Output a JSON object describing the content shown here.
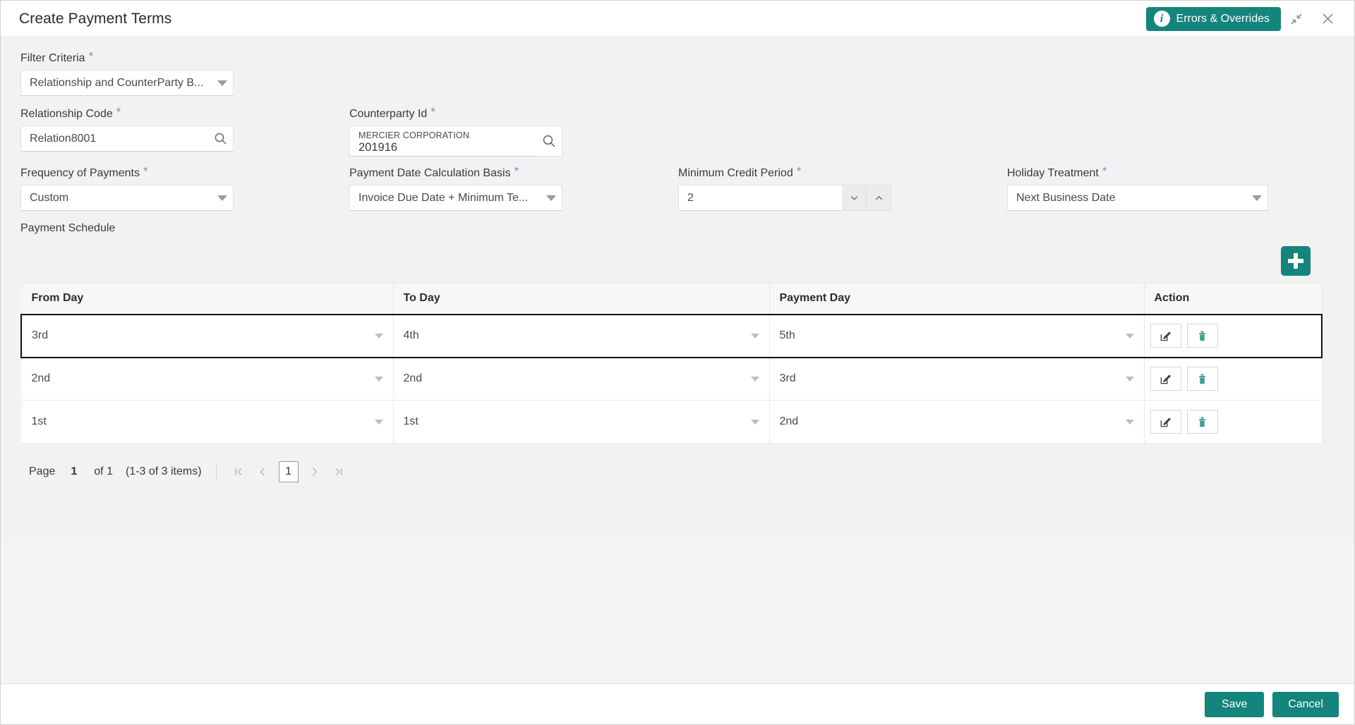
{
  "window": {
    "title": "Create Payment Terms",
    "errors_button": "Errors & Overrides",
    "info_icon": "info-icon",
    "minimize_icon": "collapse-icon",
    "close_icon": "close-icon"
  },
  "form": {
    "filter_criteria": {
      "label": "Filter Criteria",
      "required": "*",
      "value": "Relationship and CounterParty B..."
    },
    "relationship_code": {
      "label": "Relationship Code",
      "required": "*",
      "value": "Relation8001",
      "search_icon": "search-icon"
    },
    "counterparty_id": {
      "label": "Counterparty Id",
      "required": "*",
      "name_line": "MERCIER CORPORATION",
      "id_line": "201916",
      "search_icon": "search-icon"
    },
    "frequency_of_payments": {
      "label": "Frequency of Payments",
      "required": "*",
      "value": "Custom"
    },
    "payment_date_calculation_basis": {
      "label": "Payment Date Calculation Basis",
      "required": "*",
      "value": "Invoice Due Date + Minimum Te..."
    },
    "minimum_credit_period": {
      "label": "Minimum Credit Period",
      "required": "*",
      "value": "2",
      "decrement_icon": "chevron-down-icon",
      "increment_icon": "chevron-up-icon"
    },
    "holiday_treatment": {
      "label": "Holiday Treatment",
      "required": "*",
      "value": "Next Business Date"
    }
  },
  "payment_schedule": {
    "section_label": "Payment Schedule",
    "add_button_icon": "plus-icon",
    "columns": [
      "From Day",
      "To Day",
      "Payment Day",
      "Action"
    ],
    "rows": [
      {
        "from_day": "3rd",
        "to_day": "4th",
        "payment_day": "5th",
        "selected": true
      },
      {
        "from_day": "2nd",
        "to_day": "2nd",
        "payment_day": "3rd",
        "selected": false
      },
      {
        "from_day": "1st",
        "to_day": "1st",
        "payment_day": "2nd",
        "selected": false
      }
    ],
    "row_actions": {
      "edit_icon": "edit-icon",
      "delete_icon": "trash-icon"
    }
  },
  "pagination": {
    "page_word": "Page",
    "current_page": "1",
    "of_label": "of 1",
    "items_label": "(1-3 of 3 items)",
    "first_icon": "first-page-icon",
    "prev_icon": "prev-page-icon",
    "page_number": "1",
    "next_icon": "next-page-icon",
    "last_icon": "last-page-icon"
  },
  "footer": {
    "save_label": "Save",
    "cancel_label": "Cancel"
  },
  "colors": {
    "accent": "#13857c",
    "required_star": "#5b9bd5",
    "delete_icon": "#3f9a92"
  }
}
